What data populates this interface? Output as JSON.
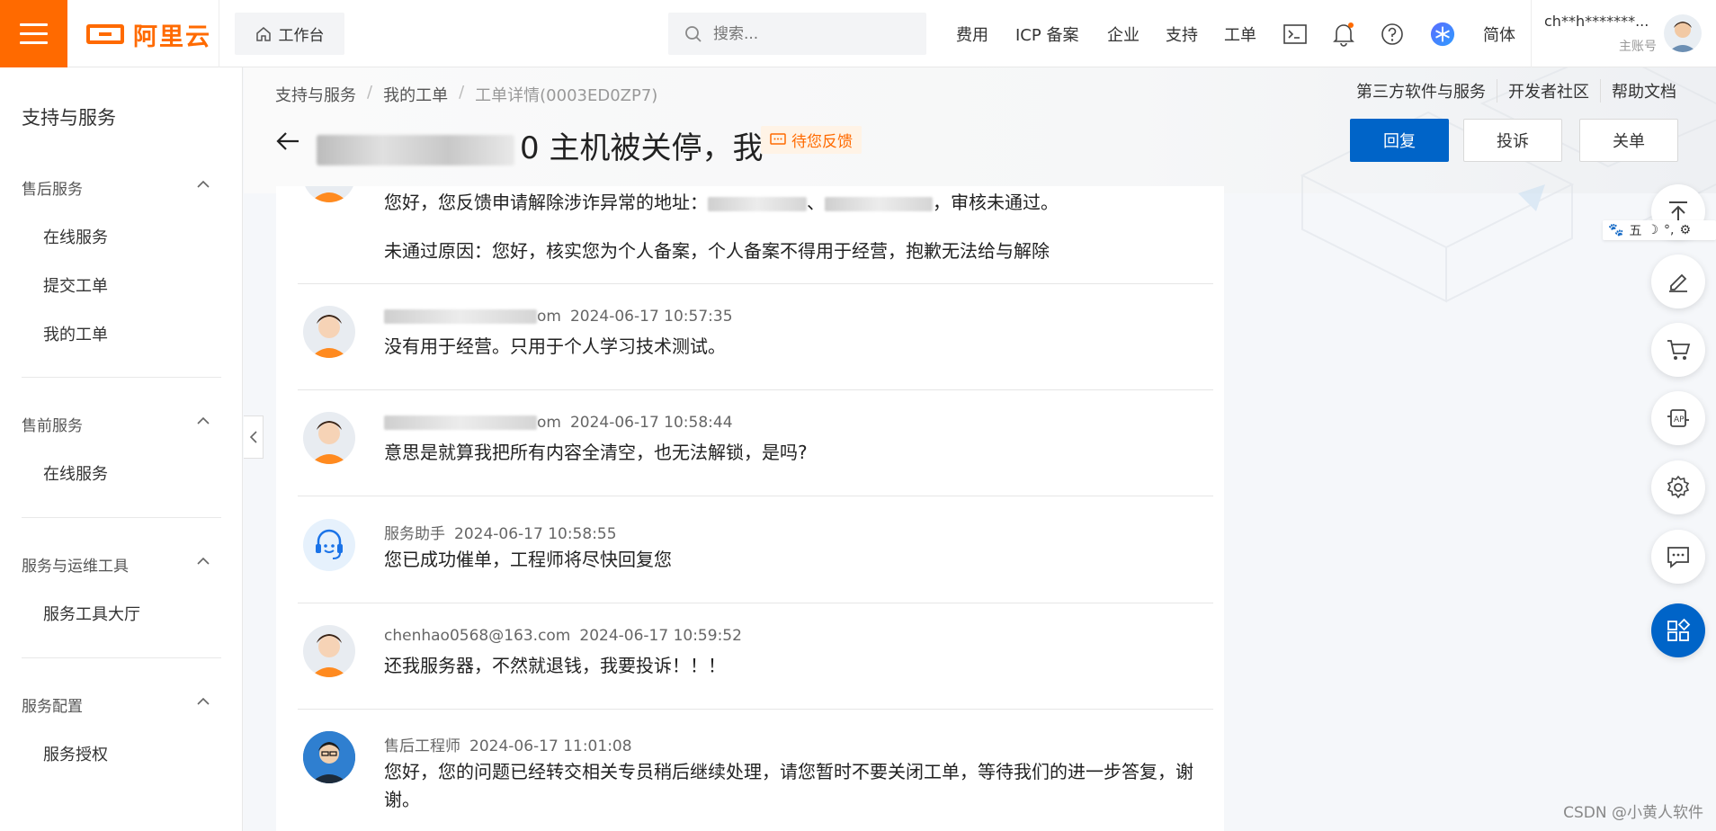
{
  "topbar": {
    "brand": "阿里云",
    "workbench": "工作台",
    "search_placeholder": "搜索...",
    "nav": [
      "费用",
      "ICP 备案",
      "企业",
      "支持",
      "工单"
    ],
    "language": "简体",
    "user_name": "ch**h*******...",
    "user_role": "主账号"
  },
  "sidebar": {
    "title": "支持与服务",
    "groups": [
      {
        "label": "售后服务",
        "items": [
          "在线服务",
          "提交工单",
          "我的工单"
        ]
      },
      {
        "label": "售前服务",
        "items": [
          "在线服务"
        ]
      },
      {
        "label": "服务与运维工具",
        "items": [
          "服务工具大厅"
        ]
      },
      {
        "label": "服务配置",
        "items": [
          "服务授权"
        ]
      }
    ]
  },
  "header": {
    "breadcrumb": [
      "支持与服务",
      "我的工单",
      "工单详情(0003ED0ZP7)"
    ],
    "title_visible": "0 主机被关停，我",
    "status": "待您反馈",
    "top_links": [
      "第三方软件与服务",
      "开发者社区",
      "帮助文档"
    ],
    "actions": {
      "reply": "回复",
      "complain": "投诉",
      "close": "关单"
    }
  },
  "messages": [
    {
      "author": "",
      "time": "",
      "body_parts": [
        "您好，您反馈申请解除涉诈异常的地址：",
        "、",
        "，审核未通过。"
      ],
      "body2": "未通过原因：您好，核实您为个人备案，个人备案不得用于经营，抱歉无法给与解除"
    },
    {
      "author_visible": "om",
      "time": "2024-06-17 10:57:35",
      "body": "没有用于经营。只用于个人学习技术测试。"
    },
    {
      "author_visible": "om",
      "time": "2024-06-17 10:58:44",
      "body": "意思是就算我把所有内容全清空，也无法解锁，是吗?"
    },
    {
      "author": "服务助手",
      "time": "2024-06-17 10:58:55",
      "body": "您已成功催单，工程师将尽快回复您"
    },
    {
      "author": "chenhao0568@163.com",
      "time": "2024-06-17 10:59:52",
      "body": "还我服务器，不然就退钱，我要投诉！！！"
    },
    {
      "author": "售后工程师",
      "time": "2024-06-17 11:01:08",
      "body": "您好，您的问题已经转交相关专员稍后继续处理，请您暂时不要关闭工单，等待我们的进一步答复，谢谢。"
    }
  ],
  "ime": {
    "mode": "五"
  },
  "watermark": "CSDN @小黄人软件",
  "colors": {
    "brand": "#ff6a00",
    "primary": "#0064c8"
  }
}
